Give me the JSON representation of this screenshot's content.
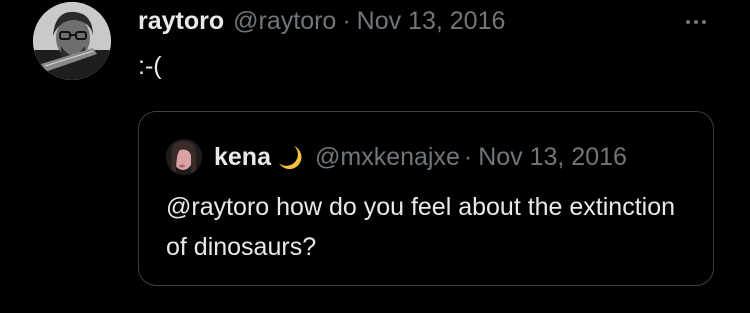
{
  "tweet": {
    "author_name": "raytoro",
    "author_handle": "@raytoro",
    "separator": "·",
    "date": "Nov 13, 2016",
    "text": ":-(",
    "more_icon": "more-horizontal-icon"
  },
  "quoted_tweet": {
    "author_name": "kena",
    "name_emoji": "crescent-moon-icon",
    "author_handle": "@mxkenajxe",
    "separator": "·",
    "date": "Nov 13, 2016",
    "text": "@raytoro how do you feel about the extinction of dinosaurs?"
  },
  "colors": {
    "background": "#000000",
    "primary_text": "#e7e9ea",
    "secondary_text": "#71767b",
    "border": "#3b3f43",
    "moon": "#f5c242"
  }
}
